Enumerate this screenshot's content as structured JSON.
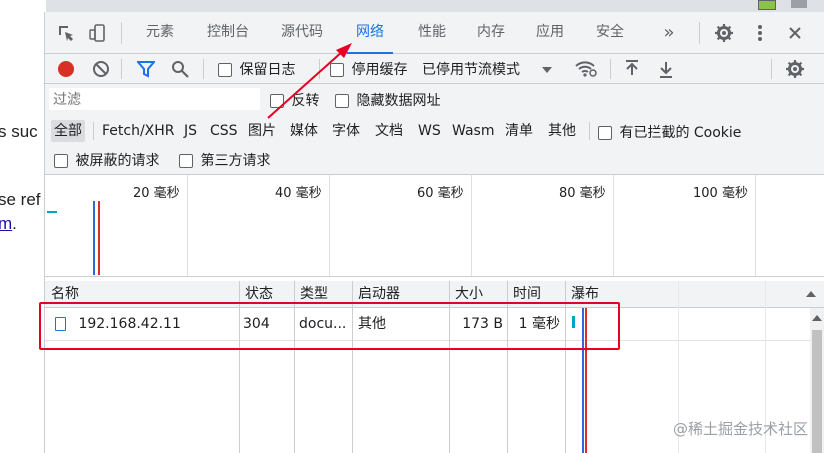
{
  "background_page": {
    "line1": "s suc",
    "line2": "se ref",
    "line3_link": "m",
    "line3_tail": "."
  },
  "tabs": {
    "items": [
      "元素",
      "控制台",
      "源代码",
      "网络",
      "性能",
      "内存",
      "应用",
      "安全"
    ],
    "active": "网络",
    "more": "»"
  },
  "toolbar": {
    "preserve_log": "保留日志",
    "disable_cache": "停用缓存",
    "throttling": "已停用节流模式"
  },
  "filter": {
    "placeholder": "过滤",
    "invert": "反转",
    "hide_data_urls": "隐藏数据网址",
    "types": [
      "全部",
      "Fetch/XHR",
      "JS",
      "CSS",
      "图片",
      "媒体",
      "字体",
      "文档",
      "WS",
      "Wasm",
      "清单",
      "其他"
    ],
    "selected_type": "全部",
    "blocked_cookies": "有已拦截的 Cookie",
    "blocked_requests": "被屏蔽的请求",
    "third_party": "第三方请求"
  },
  "overview": {
    "ticks": [
      "20 毫秒",
      "40 毫秒",
      "60 毫秒",
      "80 毫秒",
      "100 毫秒"
    ]
  },
  "table": {
    "columns": [
      "名称",
      "状态",
      "类型",
      "启动器",
      "大小",
      "时间",
      "瀑布"
    ],
    "rows": [
      {
        "name": "192.168.42.11",
        "status": "304",
        "type": "docu...",
        "initiator": "其他",
        "size": "173 B",
        "time": "1 毫秒"
      }
    ]
  },
  "watermark": "@稀土掘金技术社区",
  "colors": {
    "accent": "#1a73e8",
    "record": "#d93025",
    "highlight": "#e60023"
  }
}
